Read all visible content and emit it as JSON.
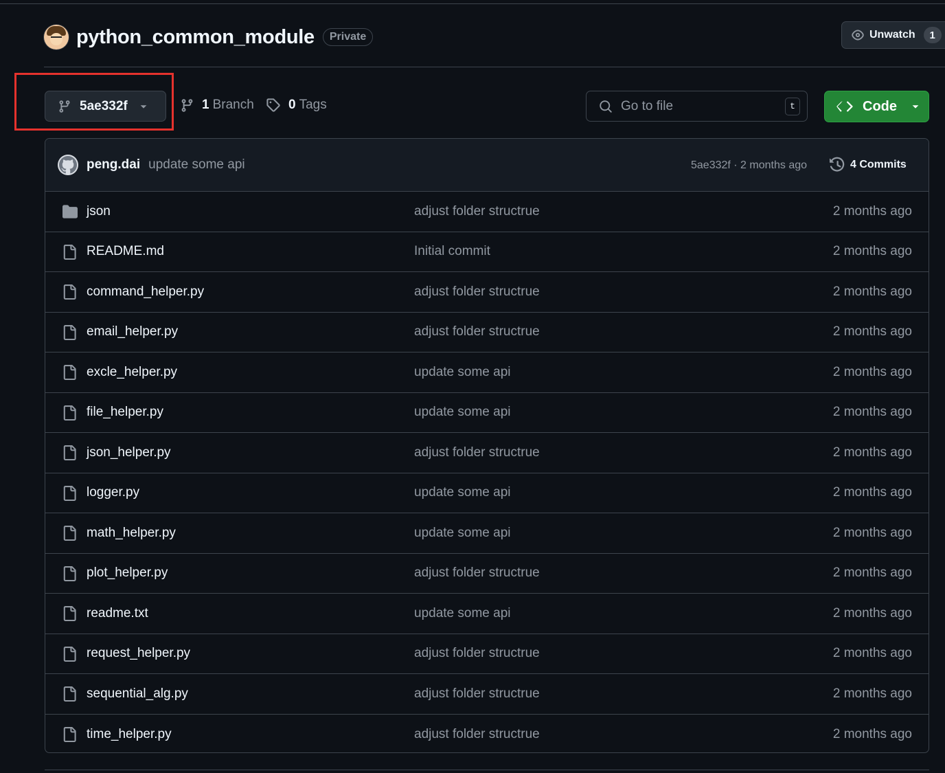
{
  "repo": {
    "name": "python_common_module",
    "visibility": "Private",
    "unwatch_label": "Unwatch",
    "watch_count": "1"
  },
  "toolbar": {
    "current_ref": "5ae332f",
    "branch_count": "1",
    "branch_label": "Branch",
    "tag_count": "0",
    "tag_label": "Tags",
    "goto_placeholder": "Go to file",
    "goto_shortcut": "t",
    "code_label": "Code",
    "code_color": "#238636"
  },
  "latest_commit": {
    "author": "peng.dai",
    "message": "update some api",
    "meta": "5ae332f · 2 months ago",
    "commits_label": "4 Commits"
  },
  "files": [
    {
      "icon": "folder-icon",
      "name": "json",
      "message": "adjust folder structrue",
      "age": "2 months ago"
    },
    {
      "icon": "file-icon",
      "name": "README.md",
      "message": "Initial commit",
      "age": "2 months ago"
    },
    {
      "icon": "file-icon",
      "name": "command_helper.py",
      "message": "adjust folder structrue",
      "age": "2 months ago"
    },
    {
      "icon": "file-icon",
      "name": "email_helper.py",
      "message": "adjust folder structrue",
      "age": "2 months ago"
    },
    {
      "icon": "file-icon",
      "name": "excle_helper.py",
      "message": "update some api",
      "age": "2 months ago"
    },
    {
      "icon": "file-icon",
      "name": "file_helper.py",
      "message": "update some api",
      "age": "2 months ago"
    },
    {
      "icon": "file-icon",
      "name": "json_helper.py",
      "message": "adjust folder structrue",
      "age": "2 months ago"
    },
    {
      "icon": "file-icon",
      "name": "logger.py",
      "message": "update some api",
      "age": "2 months ago"
    },
    {
      "icon": "file-icon",
      "name": "math_helper.py",
      "message": "update some api",
      "age": "2 months ago"
    },
    {
      "icon": "file-icon",
      "name": "plot_helper.py",
      "message": "adjust folder structrue",
      "age": "2 months ago"
    },
    {
      "icon": "file-icon",
      "name": "readme.txt",
      "message": "update some api",
      "age": "2 months ago"
    },
    {
      "icon": "file-icon",
      "name": "request_helper.py",
      "message": "adjust folder structrue",
      "age": "2 months ago"
    },
    {
      "icon": "file-icon",
      "name": "sequential_alg.py",
      "message": "adjust folder structrue",
      "age": "2 months ago"
    },
    {
      "icon": "file-icon",
      "name": "time_helper.py",
      "message": "adjust folder structrue",
      "age": "2 months ago"
    }
  ],
  "annotation": {
    "highlight_color": "#e5322d"
  }
}
